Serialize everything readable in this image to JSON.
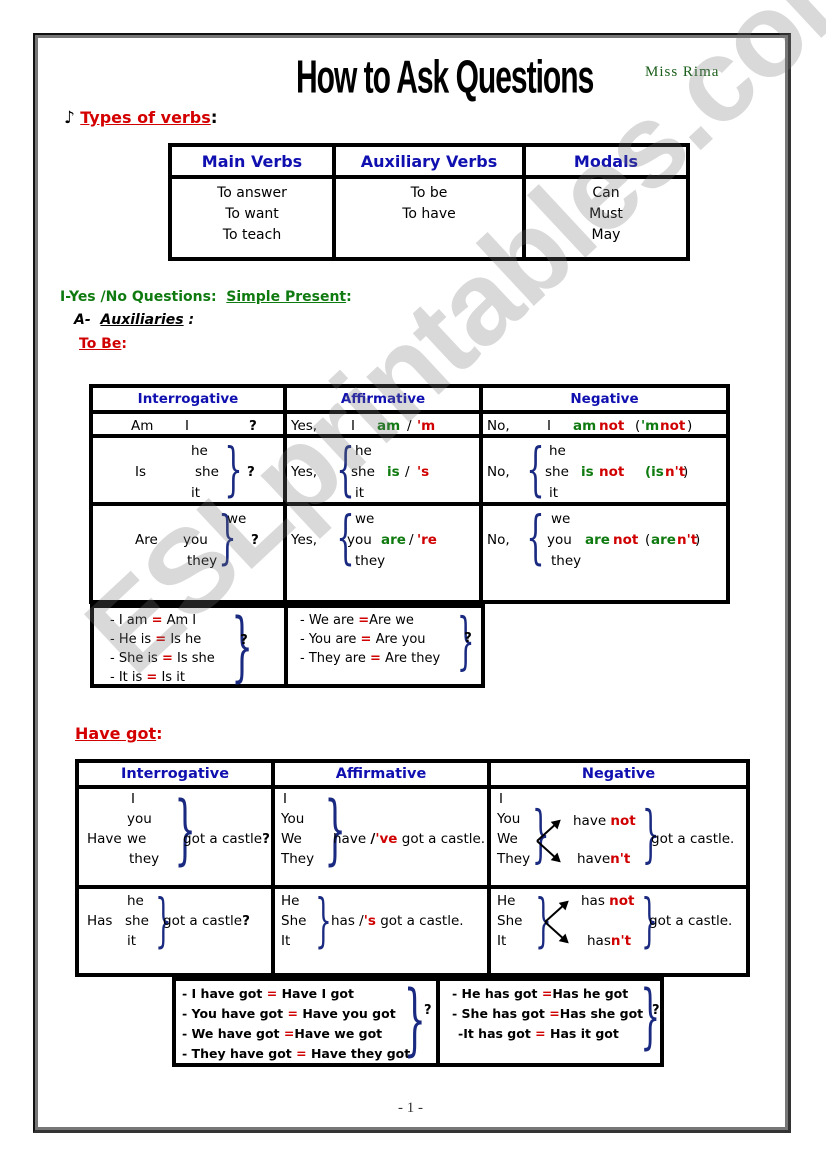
{
  "header": {
    "title": "How to Ask Questions",
    "author": "Miss Rima",
    "bullet_icon": "♪"
  },
  "types_of_verbs": {
    "heading": "Types of verbs",
    "colon": ":",
    "columns": [
      {
        "header": "Main Verbs",
        "items": [
          "To answer",
          "To want",
          "To teach"
        ]
      },
      {
        "header": "Auxiliary Verbs",
        "items": [
          "To be",
          "To have"
        ]
      },
      {
        "header": "Modals",
        "items": [
          "Can",
          "Must",
          "May"
        ]
      }
    ]
  },
  "section1": {
    "heading": "I-Yes /No Questions:",
    "subheading": "Simple Present",
    "colon": ":",
    "part_a_prefix": "A-",
    "part_a_label": "Auxiliaries",
    "part_a_colon": ":",
    "to_be_label": "To Be",
    "to_be_colon": ":"
  },
  "to_be_table": {
    "headers": [
      "Interrogative",
      "Affirmative",
      "Negative"
    ],
    "row1": {
      "interrogative": {
        "verb": "Am",
        "subject": "I",
        "mark": "?"
      },
      "affirmative": {
        "yes": "Yes,",
        "subject": "I",
        "full": "am",
        "slash": "/",
        "short": "'m"
      },
      "negative": {
        "no": "No,",
        "subject": "I",
        "full": "am",
        "not": "not",
        "short_open": "(",
        "short_m": "'m",
        "short_not": "not",
        "short_close": ")"
      }
    },
    "row2": {
      "interrogative": {
        "verb": "Is",
        "subjects": [
          "he",
          "she",
          "it"
        ],
        "mark": "?"
      },
      "affirmative": {
        "yes": "Yes,",
        "subjects": [
          "he",
          "she",
          "it"
        ],
        "full": "is",
        "slash": "/",
        "short": "'s"
      },
      "negative": {
        "no": "No,",
        "subjects": [
          "he",
          "she",
          "it"
        ],
        "full": "is",
        "not": "not",
        "short_open": "(is",
        "short_nt": "n't",
        "short_close": ")"
      }
    },
    "row3": {
      "interrogative": {
        "verb": "Are",
        "subjects": [
          "we",
          "you",
          "they"
        ],
        "mark": "?"
      },
      "affirmative": {
        "yes": "Yes,",
        "subjects": [
          "we",
          "you",
          "they"
        ],
        "full": "are",
        "slash": "/",
        "short": "'re"
      },
      "negative": {
        "no": "No,",
        "subjects": [
          "we",
          "you",
          "they"
        ],
        "full": "are",
        "not": "not",
        "short_open": "(",
        "short_are": "are",
        "short_nt": "n't",
        "short_close": ")"
      }
    }
  },
  "to_be_inversion": {
    "left": [
      {
        "statement": "- I  am",
        "eq": "=",
        "question": "Am I"
      },
      {
        "statement": "- He is",
        "eq": "=",
        "question": "Is he"
      },
      {
        "statement": "- She is",
        "eq": "=",
        "question": "Is she"
      },
      {
        "statement": "- It  is",
        "eq": "=",
        "question": "Is it"
      }
    ],
    "left_mark": "?",
    "right": [
      {
        "statement": "- We are",
        "eq": "=",
        "question": "Are we"
      },
      {
        "statement": "- You are",
        "eq": "=",
        "question": "Are you"
      },
      {
        "statement": "- They are",
        "eq": "=",
        "question": "Are they"
      }
    ],
    "right_mark": "?"
  },
  "have_got": {
    "heading": "Have got",
    "colon": ":",
    "headers": [
      "Interrogative",
      "Affirmative",
      "Negative"
    ],
    "row1": {
      "interrogative": {
        "verb": "Have",
        "subjects": [
          "I",
          "you",
          "we",
          "they"
        ],
        "rest": "got a castle",
        "mark": "?"
      },
      "affirmative": {
        "subjects": [
          "I",
          "You",
          "We",
          "They"
        ],
        "full": "have",
        "slash": "/",
        "short": "'ve",
        "rest": "got a castle."
      },
      "negative": {
        "subjects": [
          "I",
          "You",
          "We",
          "They"
        ],
        "long_a": "have",
        "long_not": "not",
        "short_a": "have",
        "short_nt": "n't",
        "rest": "got a castle."
      }
    },
    "row2": {
      "interrogative": {
        "verb": "Has",
        "subjects": [
          "he",
          "she",
          "it"
        ],
        "rest": "got a castle",
        "mark": "?"
      },
      "affirmative": {
        "subjects": [
          "He",
          "She",
          "It"
        ],
        "full": "has",
        "slash": "/",
        "short": "'s",
        "rest": "got a castle."
      },
      "negative": {
        "subjects": [
          "He",
          "She",
          "It"
        ],
        "long_a": "has",
        "long_not": "not",
        "short_a": "has",
        "short_nt": "n't",
        "rest": "got a castle."
      }
    }
  },
  "have_got_inversion": {
    "left": [
      {
        "statement": "-  I have got",
        "eq": "=",
        "question": "Have I got"
      },
      {
        "statement": "- You have got",
        "eq": "=",
        "question": "Have you got"
      },
      {
        "statement": "- We have got",
        "eq": "=",
        "question": "Have we got"
      },
      {
        "statement": "- They have got",
        "eq": "=",
        "question": "Have they got"
      }
    ],
    "left_mark": "?",
    "right": [
      {
        "statement": "- He has got",
        "eq": "=",
        "question": "Has he got"
      },
      {
        "statement": "- She has got",
        "eq": "=",
        "question": "Has she got"
      },
      {
        "statement": "-It has got",
        "eq": "=",
        "question": "Has it got"
      }
    ],
    "right_mark": "?"
  },
  "watermark": "ESLprintables.com",
  "footer": {
    "page_number": "- 1 -"
  }
}
